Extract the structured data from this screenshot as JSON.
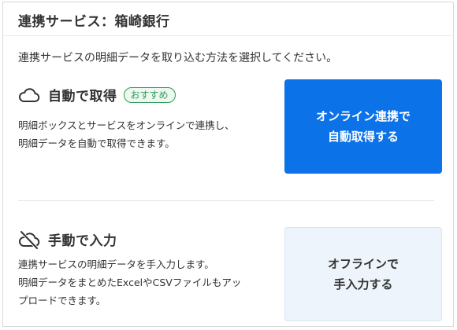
{
  "header": {
    "title": "連携サービス：箱崎銀行"
  },
  "description": "連携サービスの明細データを取り込む方法を選択してください。",
  "auto": {
    "title": "自動で取得",
    "badge": "おすすめ",
    "lines": [
      "明細ボックスとサービスをオンラインで連携し、",
      "明細データを自動で取得できます。"
    ],
    "button_line1": "オンライン連携で",
    "button_line2": "自動取得する",
    "icon": "cloud-icon"
  },
  "manual": {
    "title": "手動で入力",
    "lines": [
      "連携サービスの明細データを手入力します。",
      "明細データをまとめたExcelやCSVファイルもアッ",
      "プロードできます。"
    ],
    "button_line1": "オフラインで",
    "button_line2": "手入力する",
    "icon": "cloud-off-icon"
  },
  "colors": {
    "primary": "#0b72e7",
    "badge_green": "#2e9b55",
    "offline_bg": "#edf4fc"
  }
}
